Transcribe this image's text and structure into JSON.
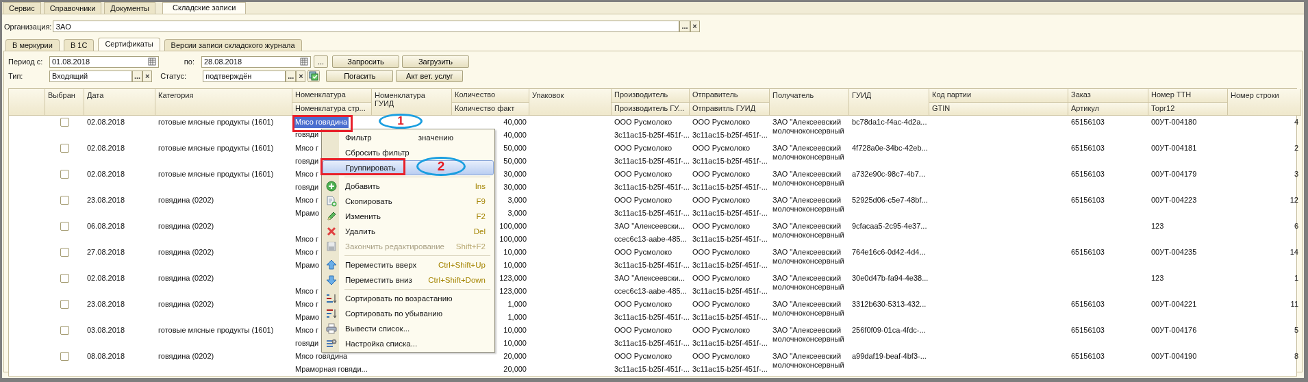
{
  "top_tabs": [
    {
      "label": "Сервис",
      "selected": false
    },
    {
      "label": "Справочники",
      "selected": false
    },
    {
      "label": "Документы",
      "selected": false
    },
    {
      "label": "Складские записи",
      "selected": true
    }
  ],
  "organization": {
    "label": "Организация:",
    "value": "ЗАО",
    "buttons": [
      "...",
      "×"
    ]
  },
  "sub_tabs": [
    {
      "label": "В меркурии",
      "selected": false
    },
    {
      "label": "В 1С",
      "selected": false
    },
    {
      "label": "Сертификаты",
      "selected": true
    },
    {
      "label": "Версии записи складского журнала",
      "selected": false
    }
  ],
  "filters": {
    "period_from": {
      "label": "Период с:",
      "value": "01.08.2018"
    },
    "period_to": {
      "label": "по:",
      "value": "28.08.2018"
    },
    "period_button": "...",
    "type": {
      "label": "Тип:",
      "value": "Входящий",
      "buttons": [
        "...",
        "×"
      ]
    },
    "status": {
      "label": "Статус:",
      "value": "подтверждён",
      "buttons": [
        "...",
        "×"
      ]
    },
    "buttons": [
      "Запросить",
      "Загрузить",
      "Погасить",
      "Акт вет. услуг"
    ]
  },
  "table": {
    "columns": [
      {
        "label": "Выбран"
      },
      {
        "label": "Дата"
      },
      {
        "label": "Категория"
      },
      {
        "label": "Номенклатура",
        "sublabel": "Номенклатура стр..."
      },
      {
        "label": "Номенклатура ГУИД"
      },
      {
        "label": "Количество",
        "sublabel": "Количество факт"
      },
      {
        "label": "Упаковок"
      },
      {
        "label": "Производитель",
        "sublabel": "Производитель ГУ..."
      },
      {
        "label": "Отправитель",
        "sublabel": "Отправитль ГУИД"
      },
      {
        "label": "Получатель"
      },
      {
        "label": "ГУИД"
      },
      {
        "label": "Код партии",
        "sublabel": "GTIN"
      },
      {
        "label": "Заказ",
        "sublabel": "Артикул"
      },
      {
        "label": "Номер ТТН",
        "sublabel": "Торг12"
      },
      {
        "label": "Номер строки"
      }
    ],
    "rows": [
      {
        "checked": false,
        "date": "02.08.2018",
        "category": "готовые мясные продукты (1601)",
        "nom1": {
          "text": "Мясо говядина",
          "selected": true
        },
        "nom2": "говяди",
        "qty1": "40,000",
        "qty2": "40,000",
        "producer1": "ООО Русмолоко",
        "producer2": "3c11ac15-b25f-451f-...",
        "sender1": "ООО Русмолоко",
        "sender2": "3c11ac15-b25f-451f-...",
        "recipient": "ЗАО \"Алексеевский молочноконсервный",
        "guid": "bc78da1c-f4ac-4d2a...",
        "order": "65156103",
        "ttn": "00УТ-004180",
        "line_no": "4"
      },
      {
        "checked": false,
        "date": "02.08.2018",
        "category": "готовые мясные продукты (1601)",
        "nom1": {
          "text": "Мясо г",
          "selected": false
        },
        "nom2": "говяди",
        "qty1": "50,000",
        "qty2": "50,000",
        "producer1": "ООО Русмолоко",
        "producer2": "3c11ac15-b25f-451f-...",
        "sender1": "ООО Русмолоко",
        "sender2": "3c11ac15-b25f-451f-...",
        "recipient": "ЗАО \"Алексеевский молочноконсервный",
        "guid": "4f728a0e-34bc-42eb...",
        "order": "65156103",
        "ttn": "00УТ-004181",
        "line_no": "2"
      },
      {
        "checked": false,
        "date": "02.08.2018",
        "category": "готовые мясные продукты (1601)",
        "nom1": {
          "text": "Мясо г",
          "selected": false
        },
        "nom2": "говяди",
        "qty1": "30,000",
        "qty2": "30,000",
        "producer1": "ООО Русмолоко",
        "producer2": "3c11ac15-b25f-451f-...",
        "sender1": "ООО Русмолоко",
        "sender2": "3c11ac15-b25f-451f-...",
        "recipient": "ЗАО \"Алексеевский молочноконсервный",
        "guid": "a732e90c-98c7-4b7...",
        "order": "65156103",
        "ttn": "00УТ-004179",
        "line_no": "3"
      },
      {
        "checked": false,
        "date": "23.08.2018",
        "category": "говядина (0202)",
        "nom1": {
          "text": "Мясо г",
          "selected": false
        },
        "nom2": "Мрамо",
        "qty1": "3,000",
        "qty2": "3,000",
        "producer1": "ООО Русмолоко",
        "producer2": "3c11ac15-b25f-451f-...",
        "sender1": "ООО Русмолоко",
        "sender2": "3c11ac15-b25f-451f-...",
        "recipient": "ЗАО \"Алексеевский молочноконсервный",
        "guid": "52925d06-c5e7-48bf...",
        "order": "65156103",
        "ttn": "00УТ-004223",
        "line_no": "12"
      },
      {
        "checked": false,
        "date": "06.08.2018",
        "category": "говядина (0202)",
        "nom2": "Мясо г",
        "qty1": "100,000",
        "qty2": "100,000",
        "producer1": "ЗАО \"Алексеевски...",
        "producer2": "ccec6c13-aabe-485...",
        "sender1": "ООО Русмолоко",
        "sender2": "3c11ac15-b25f-451f-...",
        "recipient": "ЗАО \"Алексеевский молочноконсервный",
        "guid": "9cfacaa5-2c95-4e37...",
        "ttn": "123",
        "line_no": "6"
      },
      {
        "checked": false,
        "date": "27.08.2018",
        "category": "говядина (0202)",
        "nom1": {
          "text": "Мясо г",
          "selected": false
        },
        "nom2": "Мрамо",
        "qty1": "10,000",
        "qty2": "10,000",
        "producer1": "ООО Русмолоко",
        "producer2": "3c11ac15-b25f-451f-...",
        "sender1": "ООО Русмолоко",
        "sender2": "3c11ac15-b25f-451f-...",
        "recipient": "ЗАО \"Алексеевский молочноконсервный",
        "guid": "764e16c6-0d42-4d4...",
        "order": "65156103",
        "ttn": "00УТ-004235",
        "line_no": "14"
      },
      {
        "checked": false,
        "date": "02.08.2018",
        "category": "говядина (0202)",
        "nom2": "Мясо г",
        "qty1": "123,000",
        "qty2": "123,000",
        "producer1": "ЗАО \"Алексеевски...",
        "producer2": "ccec6c13-aabe-485...",
        "sender1": "ООО Русмолоко",
        "sender2": "3c11ac15-b25f-451f-...",
        "recipient": "ЗАО \"Алексеевский молочноконсервный",
        "guid": "30e0d47b-fa94-4e38...",
        "ttn": "123",
        "line_no": "1"
      },
      {
        "checked": false,
        "date": "23.08.2018",
        "category": "говядина (0202)",
        "nom1": {
          "text": "Мясо г",
          "selected": false
        },
        "nom2": "Мрамо",
        "qty1": "1,000",
        "qty2": "1,000",
        "producer1": "ООО Русмолоко",
        "producer2": "3c11ac15-b25f-451f-...",
        "sender1": "ООО Русмолоко",
        "sender2": "3c11ac15-b25f-451f-...",
        "recipient": "ЗАО \"Алексеевский молочноконсервный",
        "guid": "3312b630-5313-432...",
        "order": "65156103",
        "ttn": "00УТ-004221",
        "line_no": "11"
      },
      {
        "checked": false,
        "date": "03.08.2018",
        "category": "готовые мясные продукты (1601)",
        "nom1": {
          "text": "Мясо г",
          "selected": false
        },
        "nom2": "говяди",
        "qty1": "10,000",
        "qty2": "10,000",
        "producer1": "ООО Русмолоко",
        "producer2": "3c11ac15-b25f-451f-...",
        "sender1": "ООО Русмолоко",
        "sender2": "3c11ac15-b25f-451f-...",
        "recipient": "ЗАО \"Алексеевский молочноконсервный",
        "guid": "256f0f09-01ca-4fdc-...",
        "order": "65156103",
        "ttn": "00УТ-004176",
        "line_no": "5"
      },
      {
        "checked": false,
        "date": "08.08.2018",
        "category": "говядина (0202)",
        "nom1": {
          "text": "Мясо говядина",
          "selected": false
        },
        "nom2": "Мраморная говяди...",
        "qty1": "20,000",
        "qty2": "20,000",
        "producer1": "ООО Русмолоко",
        "producer2": "3c11ac15-b25f-451f-...",
        "sender1": "ООО Русмолоко",
        "sender2": "3c11ac15-b25f-451f-...",
        "recipient": "ЗАО \"Алексеевский молочноконсервный",
        "guid": "a99daf19-beaf-4bf3-...",
        "order": "65156103",
        "ttn": "00УТ-004190",
        "line_no": "8"
      }
    ]
  },
  "context_menu": {
    "items": [
      {
        "kind": "plain",
        "label": "Фильтр",
        "label_tail": "значению",
        "selected": false,
        "disabled": false
      },
      {
        "kind": "plain",
        "label": "Сбросить фильтр",
        "selected": false,
        "disabled": false
      },
      {
        "kind": "plain",
        "label": "Группировать",
        "selected": true,
        "disabled": false
      },
      {
        "kind": "add",
        "label": "Добавить",
        "shortcut": "Ins",
        "separator_before": true,
        "selected": false,
        "disabled": false
      },
      {
        "kind": "copy",
        "label": "Скопировать",
        "shortcut": "F9",
        "selected": false,
        "disabled": false
      },
      {
        "kind": "edit",
        "label": "Изменить",
        "shortcut": "F2",
        "selected": false,
        "disabled": false
      },
      {
        "kind": "delete",
        "label": "Удалить",
        "shortcut": "Del",
        "selected": false,
        "disabled": false
      },
      {
        "kind": "save",
        "label": "Закончить редактирование",
        "shortcut": "Shift+F2",
        "selected": false,
        "disabled": true
      },
      {
        "kind": "up",
        "label": "Переместить вверх",
        "shortcut": "Ctrl+Shift+Up",
        "separator_before": true,
        "selected": false,
        "disabled": false
      },
      {
        "kind": "down",
        "label": "Переместить вниз",
        "shortcut": "Ctrl+Shift+Down",
        "selected": false,
        "disabled": false
      },
      {
        "kind": "sort-asc",
        "label": "Сортировать по возрастанию",
        "separator_before": true,
        "selected": false,
        "disabled": false
      },
      {
        "kind": "sort-desc",
        "label": "Сортировать по убыванию",
        "selected": false,
        "disabled": false
      },
      {
        "kind": "print",
        "label": "Вывести список...",
        "selected": false,
        "disabled": false
      },
      {
        "kind": "settings",
        "label": "Настройка списка...",
        "selected": false,
        "disabled": false
      }
    ]
  },
  "annotations": [
    {
      "label": "1"
    },
    {
      "label": "2"
    }
  ]
}
